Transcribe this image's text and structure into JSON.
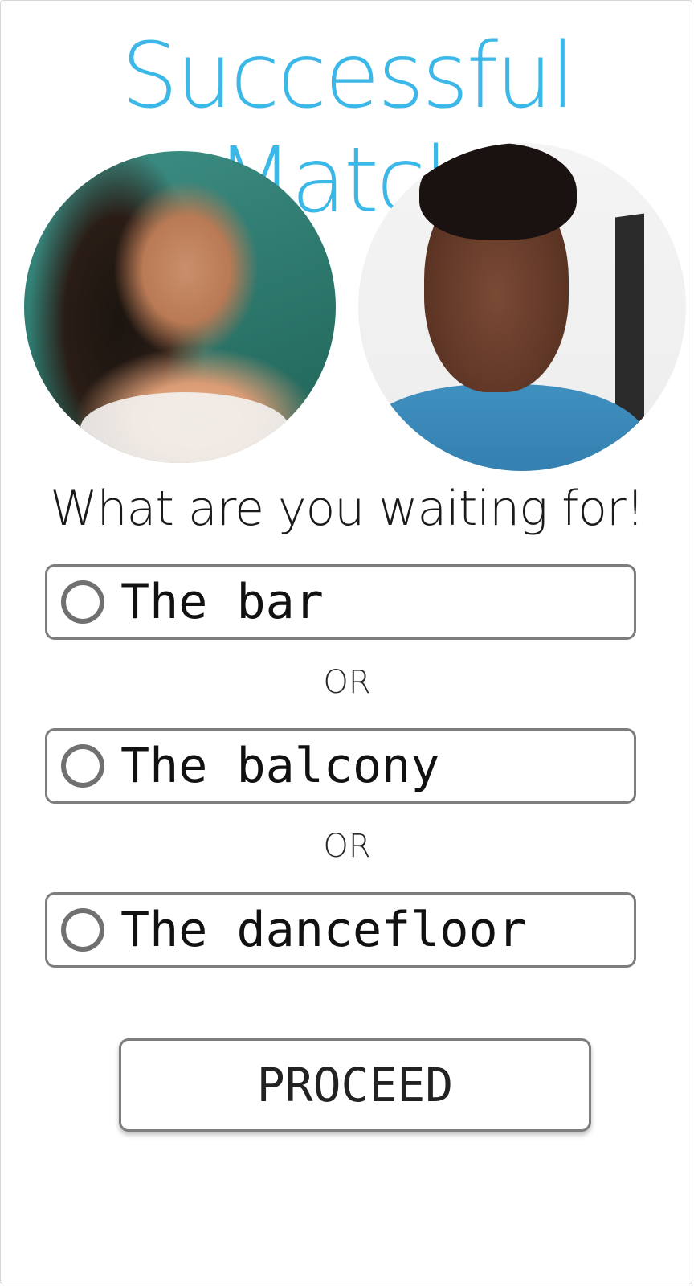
{
  "header": {
    "title": "Successful Match"
  },
  "photos": {
    "left_alt": "woman-photo",
    "right_alt": "man-photo"
  },
  "prompt": {
    "text": "What are you waiting for!"
  },
  "options": [
    {
      "label": "The bar",
      "selected": false
    },
    {
      "label": "The balcony",
      "selected": false
    },
    {
      "label": "The dancefloor",
      "selected": false
    }
  ],
  "separators": {
    "or_1": "OR",
    "or_2": "OR"
  },
  "actions": {
    "proceed_label": "PROCEED"
  },
  "colors": {
    "accent": "#3bb8e8",
    "border": "#7d7d7d",
    "text": "#111111"
  }
}
